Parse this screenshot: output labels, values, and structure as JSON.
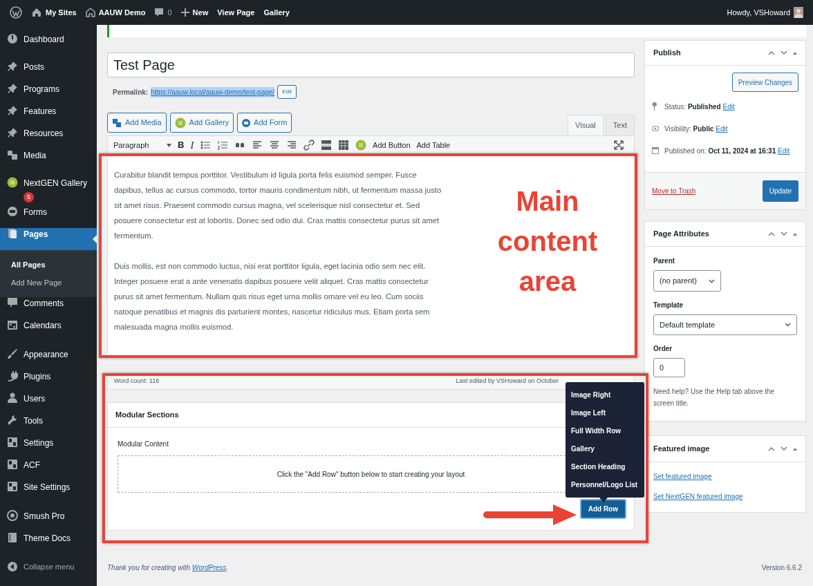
{
  "admin_bar": {
    "items": [
      {
        "kind": "logo"
      },
      {
        "kind": "sites",
        "label": "My Sites"
      },
      {
        "kind": "home",
        "label": "AAUW Demo"
      },
      {
        "kind": "comments",
        "label": "0"
      },
      {
        "kind": "new",
        "label": "New"
      },
      {
        "kind": "text",
        "label": "View Page"
      },
      {
        "kind": "text",
        "label": "Gallery"
      }
    ],
    "greeting": "Howdy, VSHoward"
  },
  "sidebar": {
    "groups": [
      {
        "items": [
          {
            "label": "Dashboard",
            "selected": false
          }
        ]
      },
      {
        "items": [
          {
            "label": "Posts",
            "selected": false
          },
          {
            "label": "Programs",
            "selected": false
          },
          {
            "label": "Features",
            "selected": false
          },
          {
            "label": "Resources",
            "selected": false
          },
          {
            "label": "Media",
            "selected": false
          },
          {
            "label": "NextGEN Gallery",
            "badge": "5",
            "selected": false
          },
          {
            "label": "Forms",
            "selected": false
          },
          {
            "label": "Pages",
            "selected": true,
            "children": [
              {
                "label": "All Pages",
                "selected": true
              },
              {
                "label": "Add New Page",
                "selected": false
              }
            ]
          },
          {
            "label": "Comments",
            "selected": false
          },
          {
            "label": "Calendars",
            "selected": false
          }
        ]
      },
      {
        "items": [
          {
            "label": "Appearance",
            "selected": false
          },
          {
            "label": "Plugins",
            "selected": false
          },
          {
            "label": "Users",
            "selected": false
          },
          {
            "label": "Tools",
            "selected": false
          },
          {
            "label": "Settings",
            "selected": false
          },
          {
            "label": "ACF",
            "selected": false
          },
          {
            "label": "Site Settings",
            "selected": false
          }
        ]
      },
      {
        "items": [
          {
            "label": "Smush Pro",
            "selected": false
          },
          {
            "label": "Theme Docs",
            "selected": false
          }
        ]
      }
    ],
    "collapse": "Collapse menu"
  },
  "editor": {
    "title": "Test Page",
    "permalink_label": "Permalink:",
    "permalink_url": "https://aauw.local/aauw-demo/test-page/",
    "permalink_edit": "Edit",
    "media_buttons": [
      {
        "kind": "media",
        "label": "Add Media"
      },
      {
        "kind": "gallery",
        "label": "Add Gallery"
      },
      {
        "kind": "form",
        "label": "Add Form"
      }
    ],
    "tabs": [
      {
        "label": "Visual",
        "selected": true
      },
      {
        "label": "Text",
        "selected": false
      }
    ],
    "toolbar": {
      "format": "Paragraph",
      "bold": "B",
      "italic": "I",
      "plugin_buttons": [
        "Add Button",
        "Add Table"
      ]
    },
    "paragraphs": [
      "Curabitur blandit tempus porttitor. Vestibulum id ligula porta felis euismod semper. Fusce dapibus, tellus ac cursus commodo, tortor mauris condimentum nibh, ut fermentum massa justo sit amet risus. Praesent commodo cursus magna, vel scelerisque nisl consectetur et. Sed posuere consectetur est at lobortis. Donec sed odio dui. Cras mattis consectetur purus sit amet fermentum.",
      "Duis mollis, est non commodo luctus, nisi erat porttitor ligula, eget lacinia odio sem nec elit. Integer posuere erat a ante venenatis dapibus posuere velit aliquet. Cras mattis consectetur purus sit amet fermentum. Nullam quis risus eget urna mollis ornare vel eu leo. Cum sociis natoque penatibus et magnis dis parturient montes, nascetur ridiculus mus. Etiam porta sem malesuada magna mollis euismod."
    ],
    "word_count": "Word count: 116",
    "last_edited": "Last edited by VSHoward on October"
  },
  "modular": {
    "title": "Modular Sections",
    "field_label": "Modular Content",
    "empty_message": "Click the \"Add Row\" button below to start creating your layout",
    "add_row": "Add Row",
    "menu": [
      "Image Right",
      "Image Left",
      "Full Width Row",
      "Gallery",
      "Section Heading",
      "Personnel/Logo List"
    ]
  },
  "publish": {
    "title": "Publish",
    "preview": "Preview Changes",
    "rows": [
      {
        "kind": "status",
        "label": "Status:",
        "value": "Published",
        "link": "Edit"
      },
      {
        "kind": "visibility",
        "label": "Visibility:",
        "value": "Public",
        "link": "Edit"
      },
      {
        "kind": "date",
        "label": "Published on:",
        "value": "Oct 11, 2024 at 16:31",
        "link": "Edit"
      }
    ],
    "trash": "Move to Trash",
    "update": "Update"
  },
  "page_attributes": {
    "title": "Page Attributes",
    "parent_label": "Parent",
    "parent_value": "(no parent)",
    "template_label": "Template",
    "template_value": "Default template",
    "order_label": "Order",
    "order_value": "0",
    "help": "Need help? Use the Help tab above the screen title."
  },
  "featured_image": {
    "title": "Featured image",
    "links": [
      "Set featured image",
      "Set NextGEN featured image"
    ]
  },
  "annotations": {
    "callout": "Main content area"
  },
  "footer": {
    "thanks": "Thank you for creating with ",
    "link": "WordPress",
    "after": ".",
    "version": "Version 6.6.2"
  }
}
